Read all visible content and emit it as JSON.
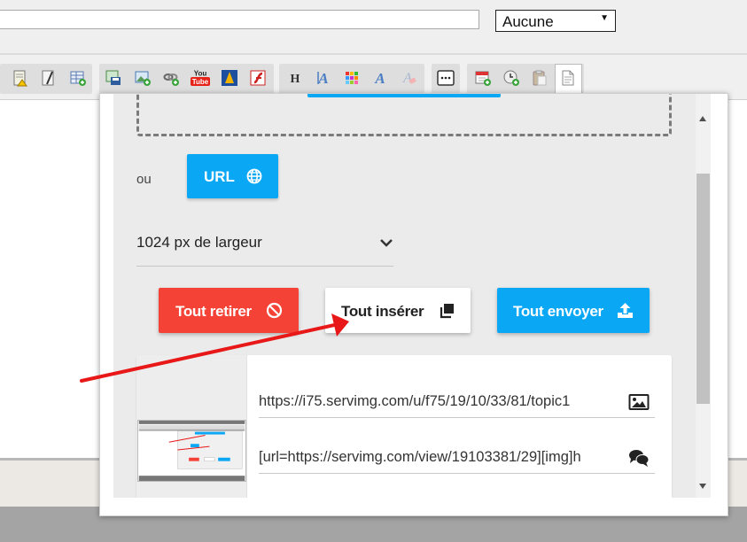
{
  "form": {
    "title_value": "",
    "select_value": "Aucune"
  },
  "toolbar": {
    "icons": [
      "notepad-warning-icon",
      "notepad-edit-icon",
      "table-add-icon",
      "save-image-icon",
      "image-upload-icon",
      "link-add-icon",
      "youtube-icon",
      "dailymotion-icon",
      "flash-icon",
      "heading-icon",
      "font-icon",
      "color-palette-icon",
      "text-style-icon",
      "clear-format-icon",
      "more-options-icon",
      "calendar-add-icon",
      "clock-add-icon",
      "paste-icon",
      "source-document-icon"
    ],
    "youtube_label": "You Tube"
  },
  "popup": {
    "or_label": "ou",
    "url_button_label": "URL",
    "width_select_value": "1024 px de largeur",
    "remove_all_label": "Tout retirer",
    "insert_all_label": "Tout insérer",
    "send_all_label": "Tout envoyer",
    "image_link": "https://i75.servimg.com/u/f75/19/10/33/81/topic1",
    "bbcode_link": "[url=https://servimg.com/view/19103381/29][img]h"
  },
  "colors": {
    "accent_blue": "#0aa7f5",
    "danger_red": "#f44336",
    "annotation_red": "#e81818"
  }
}
